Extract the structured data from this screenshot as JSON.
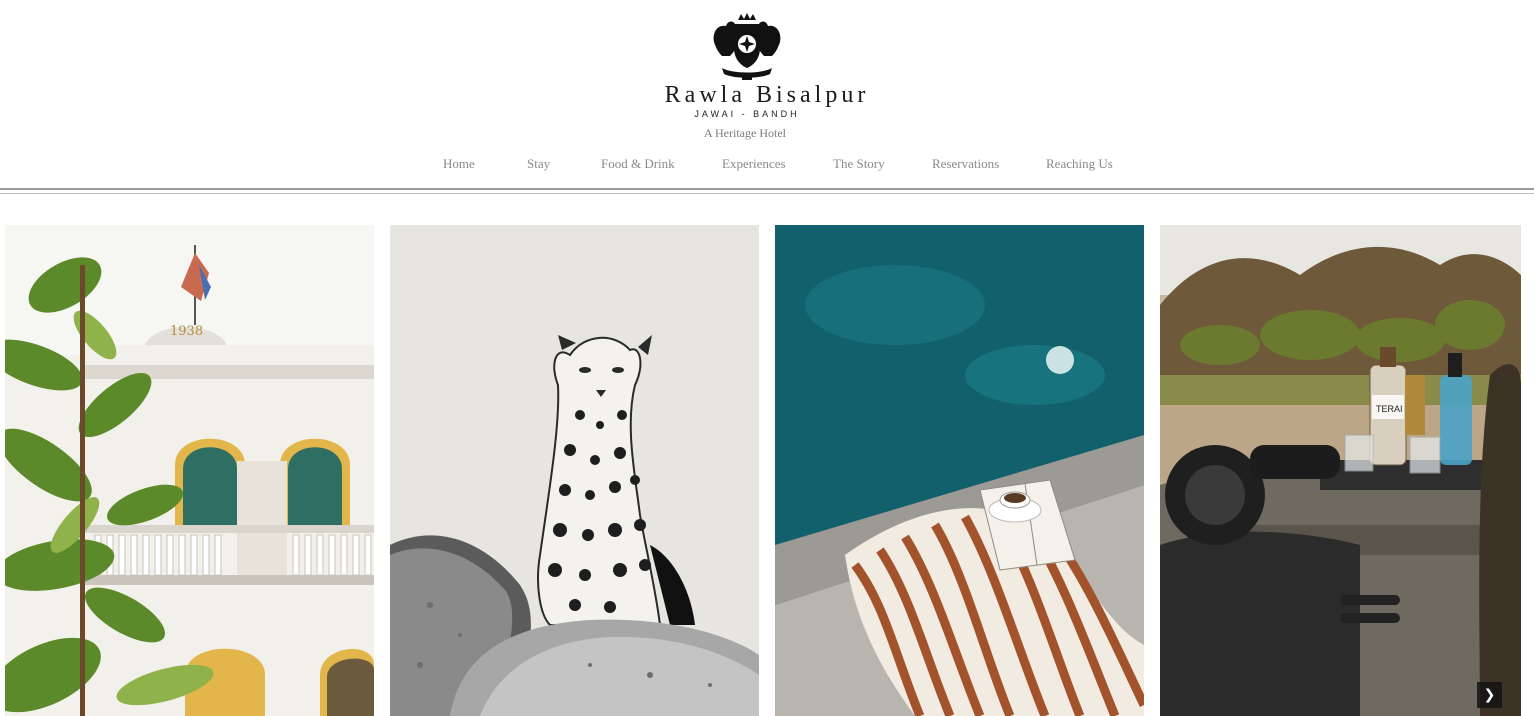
{
  "brand": {
    "name": "Rawla Bisalpur",
    "subtitle": "JAWAI - BANDH",
    "tagline": "A Heritage Hotel",
    "crest_year": "1938"
  },
  "nav": {
    "items": [
      {
        "label": "Home"
      },
      {
        "label": "Stay"
      },
      {
        "label": "Food & Drink"
      },
      {
        "label": "Experiences"
      },
      {
        "label": "The Story"
      },
      {
        "label": "Reservations"
      },
      {
        "label": "Reaching Us"
      }
    ]
  },
  "gallery": {
    "slides": [
      {
        "subject": "heritage-building",
        "year_sign": "1938"
      },
      {
        "subject": "leopard-on-rock"
      },
      {
        "subject": "poolside-towel-tea"
      },
      {
        "subject": "jeep-drinks",
        "bottle_label": "TERAI"
      }
    ],
    "next_icon": "chevron-right-icon"
  },
  "colors": {
    "nav_text": "#8a8a8a",
    "brand_text": "#1a1a1a",
    "rule": "#9a9a9a"
  }
}
